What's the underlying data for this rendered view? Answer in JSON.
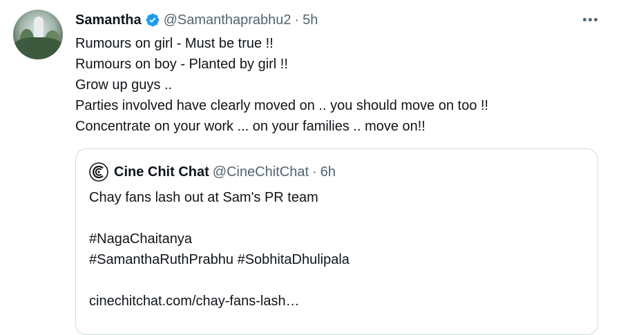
{
  "tweet": {
    "author": {
      "name": "Samantha",
      "handle": "@Samanthaprabhu2",
      "separator": "·",
      "time": "5h"
    },
    "lines": [
      "Rumours on girl - Must be true !!",
      "Rumours on boy - Planted by girl !!",
      "Grow up guys ..",
      "Parties involved have clearly moved on .. you should move on too !!",
      "Concentrate on your work ... on your families .. move on!!"
    ],
    "more_icon": "more-horizontal-icon"
  },
  "quote": {
    "author": {
      "name": "Cine Chit Chat",
      "handle": "@CineChitChat",
      "separator": "·",
      "time": "6h"
    },
    "lines": [
      "Chay fans lash out at Sam's PR team",
      "",
      "#NagaChaitanya",
      "#SamanthaRuthPrabhu #SobhitaDhulipala",
      "",
      "cinechitchat.com/chay-fans-lash…"
    ]
  },
  "colors": {
    "text": "#0f1419",
    "secondary": "#536471",
    "verified": "#1d9bf0",
    "border": "#cfd9de"
  }
}
